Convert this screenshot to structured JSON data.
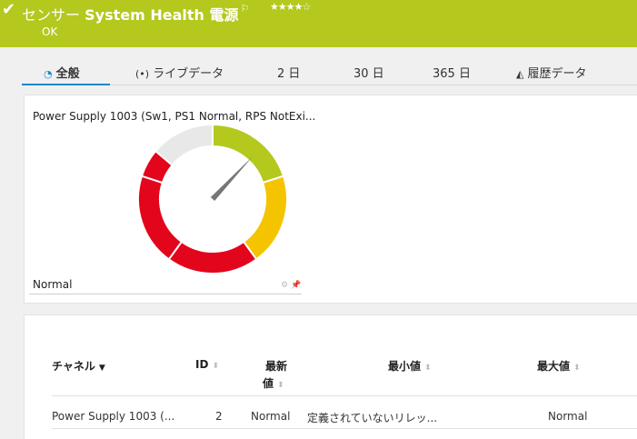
{
  "header": {
    "sensor_label": "センサー",
    "sensor_name": "System Health 電源",
    "stars": "★★★★☆",
    "status": "OK",
    "bg_color": "#b4c81e"
  },
  "tabs": [
    {
      "label": "全般",
      "icon": "gauge-icon"
    },
    {
      "label": "ライブデータ",
      "icon": "live-data-icon"
    },
    {
      "label": "2 日"
    },
    {
      "label": "30 日"
    },
    {
      "label": "365 日"
    },
    {
      "label": "履歴データ",
      "icon": "history-chart-icon"
    }
  ],
  "gauge": {
    "title": "Power Supply 1003 (Sw1, PS1 Normal, RPS NotExi...",
    "value_text": "Normal",
    "needle_fraction": 0.12,
    "colors": {
      "ok": "#b4c81e",
      "warning": "#f5c400",
      "error": "#e3051b",
      "unused": "#e8e8e8",
      "needle": "#777777"
    }
  },
  "table": {
    "headers": {
      "channel": "チャネル",
      "id": "ID",
      "latest_line1": "最新",
      "latest_line2": "値",
      "min": "最小値",
      "max": "最大値"
    },
    "rows": [
      {
        "channel": "Power Supply 1003 (...",
        "id": "2",
        "latest": "Normal",
        "min": "定義されていないリレッ...",
        "max": "Normal"
      }
    ]
  }
}
